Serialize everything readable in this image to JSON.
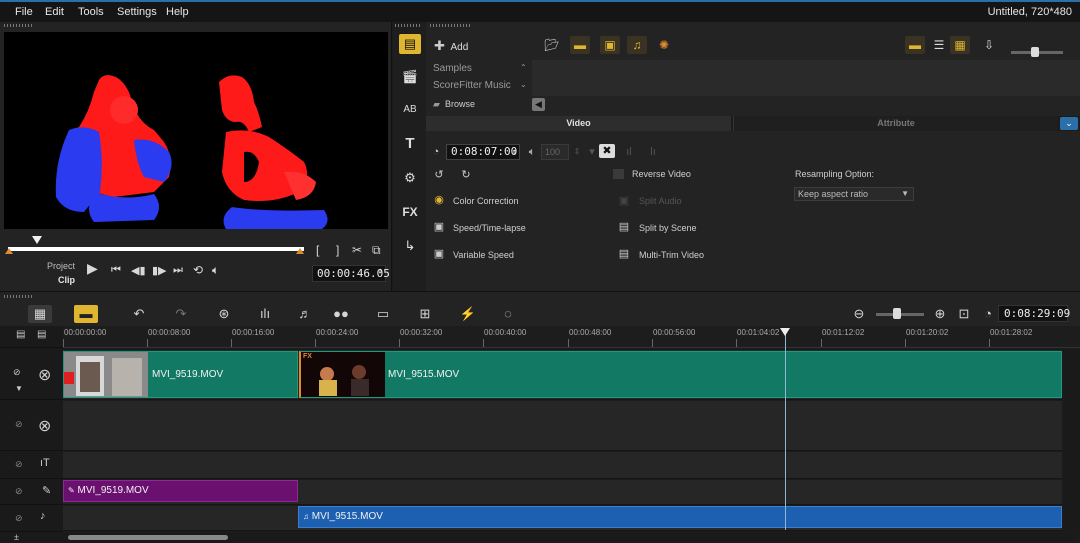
{
  "menu": {
    "items": [
      "File",
      "Edit",
      "Tools",
      "Settings",
      "Help"
    ],
    "project_info": "Untitled, 720*480"
  },
  "preview": {
    "mode_project": "Project",
    "mode_clip": "Clip",
    "timecode": "00:00:46.05",
    "mark_in": "[",
    "mark_out": "]"
  },
  "library": {
    "add_label": "Add",
    "items": [
      "Samples",
      "ScoreFitter Music"
    ],
    "browse_label": "Browse"
  },
  "options": {
    "tab_video": "Video",
    "tab_attribute": "Attribute",
    "duration": "0:08:07:00",
    "volume": "100",
    "reverse_video": "Reverse Video",
    "split_audio": "Split Audio",
    "color_correction": "Color Correction",
    "speed_timelapse": "Speed/Time-lapse",
    "split_by_scene": "Split by Scene",
    "variable_speed": "Variable Speed",
    "multi_trim": "Multi-Trim Video",
    "resampling_label": "Resampling Option:",
    "resampling_value": "Keep aspect ratio"
  },
  "timeline": {
    "timecode": "0:08:29:09",
    "ruler_labels": [
      "00:00:00:00",
      "00:00:08:00",
      "00:00:16:00",
      "00:00:24:00",
      "00:00:32:00",
      "00:00:40:00",
      "00:00:48:00",
      "00:00:56:00",
      "00:01:04:02",
      "00:01:12:02",
      "00:01:20:02",
      "00:01:28:02"
    ],
    "video_clips": [
      {
        "name": "MVI_9519.MOV"
      },
      {
        "name": "MVI_9515.MOV",
        "fx": "FX"
      }
    ],
    "voice_clip": "MVI_9519.MOV",
    "music_clip": "MVI_9515.MOV"
  },
  "colors": {
    "accent": "#e0b631",
    "video_clip": "#127a64",
    "voice_clip": "#6a1170",
    "music_clip": "#1d5fb0",
    "selection_blue": "#2b6fa8"
  }
}
